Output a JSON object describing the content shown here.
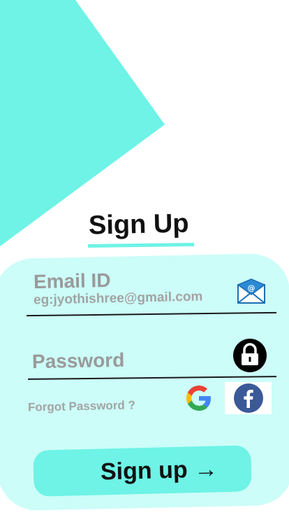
{
  "header": {
    "title": "Sign Up"
  },
  "form": {
    "email_label": "Email ID",
    "email_placeholder": "eg:jyothishree@gmail.com",
    "password_label": "Password",
    "forgot_label": "Forgot Password ?"
  },
  "actions": {
    "signup_label": "Sign up →"
  },
  "icons": {
    "email": "email-icon",
    "lock": "lock-icon",
    "google": "google-icon",
    "facebook": "facebook-icon"
  },
  "colors": {
    "accent": "#6ef3e6",
    "card": "#ccfdf8",
    "hint_text": "#9a9a9a"
  }
}
